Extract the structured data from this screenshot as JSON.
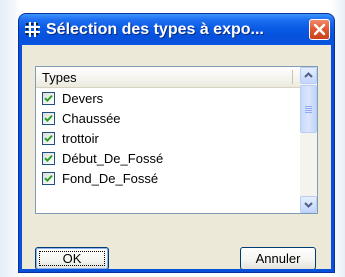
{
  "dialog": {
    "title": "Sélection des types à expo...",
    "close_icon": "close-icon",
    "app_icon": "grid-icon"
  },
  "list": {
    "header": "Types",
    "items": [
      {
        "label": "Devers",
        "checked": true
      },
      {
        "label": "Chaussée",
        "checked": true
      },
      {
        "label": "trottoir",
        "checked": true
      },
      {
        "label": "Début_De_Fossé",
        "checked": true
      },
      {
        "label": "Fond_De_Fossé",
        "checked": true
      }
    ]
  },
  "buttons": {
    "ok_label": "OK",
    "cancel_label": "Annuler"
  },
  "colors": {
    "titlebar": "#0a5be6",
    "close": "#e0582f",
    "face": "#ece9d8"
  }
}
